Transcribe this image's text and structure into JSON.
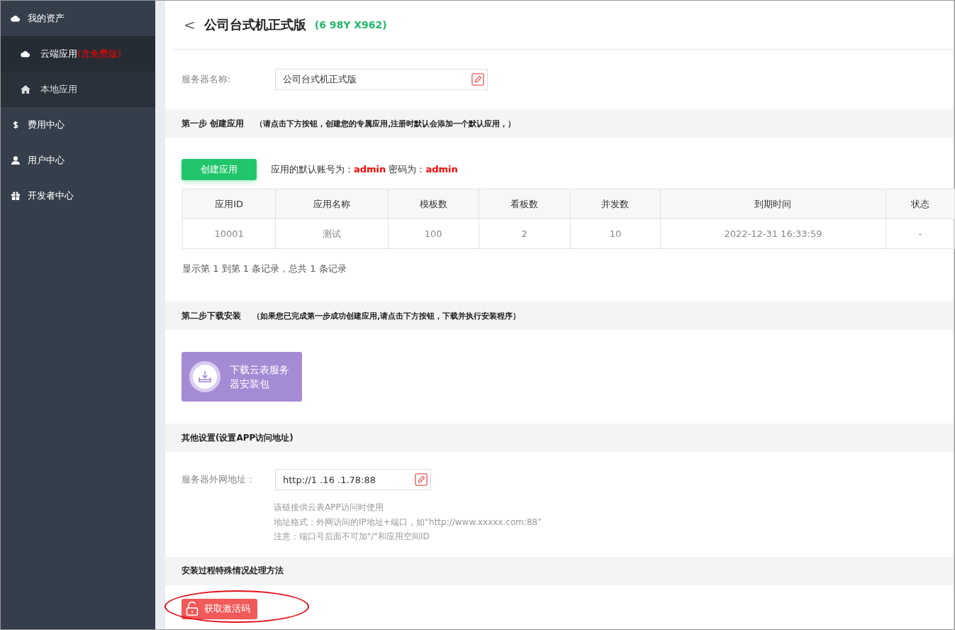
{
  "sidebar": {
    "items": [
      {
        "label": "我的资产",
        "children": [
          {
            "label": "云端应用",
            "tag": "(含免费版)",
            "selected": true
          },
          {
            "label": "本地应用",
            "selected": false
          }
        ]
      },
      {
        "label": "费用中心"
      },
      {
        "label": "用户中心"
      },
      {
        "label": "开发者中心"
      }
    ]
  },
  "header": {
    "back": "<",
    "title": "公司台式机正式版",
    "code": "(6 98Y X962)"
  },
  "server_name": {
    "label": "服务器名称:",
    "value": "公司台式机正式版"
  },
  "step1": {
    "title": "第一步 创建应用",
    "note": "（请点击下方按钮，创建您的专属应用,注册时默认会添加一个默认应用，）",
    "button": "创建应用",
    "account_text": "应用的默认账号为：**admin** 密码为：**admin**",
    "table": {
      "columns": [
        "应用ID",
        "应用名称",
        "模板数",
        "看板数",
        "并发数",
        "到期时间",
        "状态"
      ],
      "rows": [
        [
          "10001",
          "测试",
          "100",
          "2",
          "10",
          "2022-12-31 16:33:59",
          "-"
        ]
      ]
    },
    "summary": "显示第 1 到第 1 条记录，总共 1 条记录"
  },
  "step2": {
    "title": "第二步下载安装",
    "note": "（如果您已完成第一步成功创建应用,请点击下方按钮，下载并执行安装程序）",
    "download_button": "下载云表服务器安装包"
  },
  "other": {
    "title": "其他设置(设置APP访问地址)",
    "label": "服务器外网地址：",
    "value": "http://1 .16 .1.78:88",
    "hints": [
      "该链接供云表APP访问时使用",
      "地址格式：外网访问的IP地址+端口，如“http://www.xxxxx.com:88”",
      "注意：端口号后面不可加\"/\"和应用空间ID"
    ]
  },
  "install": {
    "title": "安装过程特殊情况处理方法",
    "button": "获取激活码",
    "highlighted": true
  }
}
